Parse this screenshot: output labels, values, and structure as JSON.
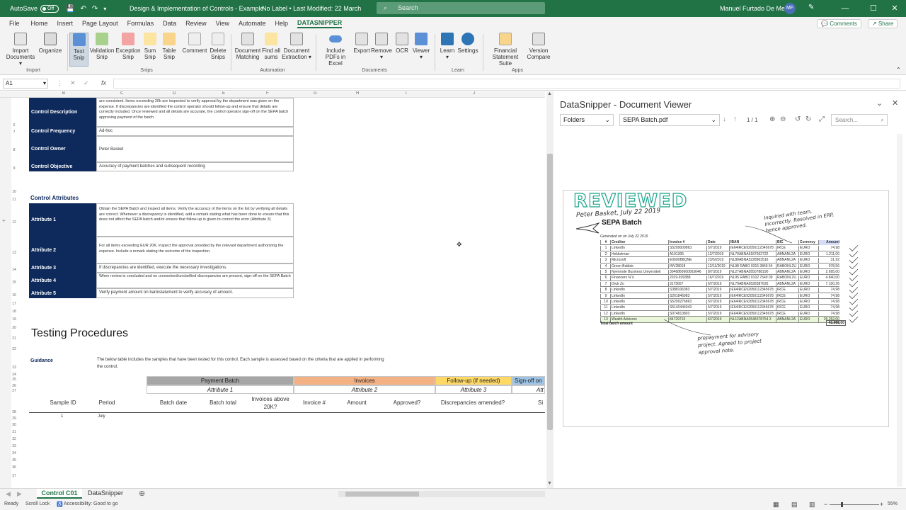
{
  "titlebar": {
    "autosave_label": "AutoSave",
    "autosave_state": "Off",
    "doc_title": "Design & Implementation of Controls - Example",
    "label_status": "No Label • Last Modified: 22 March",
    "search_placeholder": "Search",
    "user_name": "Manuel Furtado De Melo",
    "user_initials": "MF"
  },
  "menu": {
    "items": [
      "File",
      "Home",
      "Insert",
      "Page Layout",
      "Formulas",
      "Data",
      "Review",
      "View",
      "Automate",
      "Help",
      "DATASNIPPER"
    ],
    "comments": "Comments",
    "share": "Share"
  },
  "ribbon": {
    "buttons": [
      "Import Documents",
      "Organize",
      "Text Snip",
      "Validation Snip",
      "Exception Snip",
      "Sum Snip",
      "Table Snip",
      "Comment",
      "Delete Snips",
      "Document Matching",
      "Find all sums",
      "Document Extraction",
      "Include PDFs in Excel",
      "Export",
      "Remove",
      "OCR",
      "Viewer",
      "Learn",
      "Settings",
      "Financial Statement Suite",
      "Version Compare"
    ],
    "groups": [
      "Import",
      "Snips",
      "Automation",
      "Documents",
      "Learn",
      "Apps"
    ]
  },
  "formula_bar": {
    "name_box": "A1",
    "fx": "fx"
  },
  "columns": [
    "B",
    "C",
    "D",
    "E",
    "F",
    "G",
    "H",
    "I",
    "J"
  ],
  "sheet": {
    "control_rows": [
      {
        "label": "Control Description",
        "text": "are consistent. Items exceeding 20k are inspected to verify approval by the department was given on the expense. If discrepancies are identified the control operator should follow-up and ensure that details are correctly included. Once reviewed and all details are accurate, the control operator sign-off on the SEPA batch approving payment of the batch."
      },
      {
        "label": "Control Frequency",
        "text": "Ad-hoc"
      },
      {
        "label": "Control Owner",
        "text": "Peter Basket"
      },
      {
        "label": "Control Objective",
        "text": "Accuracy of payment batches and subsequent recording"
      }
    ],
    "attributes_title": "Control Attributes",
    "attributes": [
      {
        "label": "Attribute 1",
        "text": "Obtain the SEPA Batch and inspect all items. Verify the accuracy of the items on the list by verifying all details are correct. Whenever a discrepancy is identified, add a remark stating what has been done to ensure that this does not affect the SEPA batch and/or ensure that follow-up is given to correct the error (Attribute 3)"
      },
      {
        "label": "Attribute 2",
        "text": "For all items exceeding EUR 20K, inspect the approval provided by the relevant department authorizing the expense. Include a remark stating the outcome of the inspection."
      },
      {
        "label": "Attribute 3",
        "text": "If discrepancies are identified, execute the necessary investigations."
      },
      {
        "label": "Attribute 4",
        "text": "When review is concluded and no unresolved/unclarified discrepancies are present, sign-off on the SEPA Batch"
      },
      {
        "label": "Attribute 5",
        "text": "Verify payment amount on bankstatement to verify accuracy of amount."
      }
    ],
    "testing_title": "Testing Procedures",
    "guidance_label": "Guidance",
    "guidance_text": "The below table includes the samples that have been tested for this control. Each sample is assessed based on the criteria that are applied in performing the control.",
    "groups": [
      {
        "name": "Payment Batch",
        "attr": "Attribute 1",
        "color": "#a6a6a6"
      },
      {
        "name": "Invoices",
        "attr": "Attribute 2",
        "color": "#f4b183"
      },
      {
        "name": "Follow-up (if needed)",
        "attr": "Attribute 3",
        "color": "#ffd966"
      },
      {
        "name": "Sign-off on",
        "attr": "Att",
        "color": "#9dc3e6"
      }
    ],
    "table_columns": [
      "Sample ID",
      "Period",
      "Batch date",
      "Batch total",
      "Invoices above 20K?",
      "Invoice #",
      "Amount",
      "Approved?",
      "Discrepancies amended?",
      "Si"
    ],
    "sample_row": {
      "id": "1",
      "period": "July"
    },
    "row_numbers": [
      "6",
      "7",
      "8",
      "9",
      "10",
      "11",
      "12",
      "13",
      "14",
      "15",
      "16",
      "17",
      "18",
      "19",
      "20",
      "21",
      "22",
      "23",
      "24",
      "25",
      "26",
      "27",
      "28",
      "29",
      "30",
      "31",
      "32",
      "33",
      "34",
      "35",
      "36",
      "37"
    ]
  },
  "viewer": {
    "title": "DataSnipper - Document Viewer",
    "folders": "Folders",
    "file": "SEPA Batch.pdf",
    "page_indicator": "1 / 1",
    "search_placeholder": "Search..."
  },
  "document": {
    "stamp": "REVIEWED",
    "signature": "Peter Basket, July 22 2019",
    "heading": "SEPA Batch",
    "generated": "Generated on on July 22 2019",
    "note_top": "Inquired with team, incorrectly. Resolved in ERP, hence approved.",
    "note_bottom": "prepayment for advisory project. Agreed to project approval note.",
    "headers": [
      "#",
      "Creditor",
      "Invoice #",
      "Date",
      "IBAN",
      "BIC",
      "Currency",
      "Amount"
    ],
    "rows": [
      [
        "1",
        "LinkedIn",
        "S5209009863",
        "5/7/2019",
        "IE64IRCE92050112345678",
        "IRCE",
        "EURO",
        "74,98"
      ],
      [
        "2",
        "Hekkelman",
        "A191305",
        "12/7/2019",
        "NL70ABNA6187602722",
        "ABNANL2A",
        "EURO",
        "1.211,00"
      ],
      [
        "3",
        "Microsoft",
        "E0600B8QNE",
        "23/6/2019",
        "NL88ABNA5228863516",
        "ABNANL2A",
        "EURO",
        "31,92"
      ],
      [
        "4",
        "Green Bubble",
        "INV28018",
        "12/11/2019",
        "NL98 RABO 0315 3849 64",
        "RABONL2U",
        "EURO",
        "978,56"
      ],
      [
        "5",
        "Nyenrode Business Universiteit",
        "3046860600063646",
        "8/7/2019",
        "NL27ABNA0550788190",
        "ABNANL2A",
        "EURO",
        "2.695,00"
      ],
      [
        "6",
        "Financers N.V.",
        "2019-939388",
        "16/7/2019",
        "NL95 RABO 0102 7649 09",
        "RABONL2U",
        "EURO",
        "4.840,00"
      ],
      [
        "7",
        "Druk Zo",
        "3175657",
        "6/7/2019",
        "NL79ABNA0528387626",
        "ABNANL2A",
        "EURO",
        "7.100,26"
      ],
      [
        "8",
        "LinkedIn",
        "S388106383",
        "5/7/2019",
        "IE64IRCE92050112345678",
        "IRCE",
        "EURO",
        "74,98"
      ],
      [
        "9",
        "LinkedIn",
        "S261846983",
        "5/7/2019",
        "IE64IRCE92050112345678",
        "IRCE",
        "EURO",
        "74,98"
      ],
      [
        "10",
        "LinkedIn",
        "S5209276863",
        "5/7/2019",
        "IE64IRCE92050112345678",
        "IRCE",
        "EURO",
        "74,98"
      ],
      [
        "11",
        "LinkedIn",
        "S5140444043",
        "5/7/2019",
        "IE64IRCE92050112345678",
        "IRCE",
        "EURO",
        "74,98"
      ],
      [
        "12",
        "LinkedIn",
        "S074813803",
        "5/7/2019",
        "IE64IRCE92050112345678",
        "IRCE",
        "EURO",
        "74,98"
      ],
      [
        "13",
        "Wealth Advisors",
        "84729710",
        "6/7/2019",
        "NL12ABNA0548378754 3",
        "ABNANL2A",
        "EURO",
        "25.252,00"
      ]
    ],
    "total_label": "Total batch amount",
    "total_value": "41.958,00"
  },
  "tabs": {
    "sheets": [
      "Control C01",
      "DataSnipper"
    ],
    "active": "Control C01"
  },
  "status": {
    "ready": "Ready",
    "scroll_lock": "Scroll Lock",
    "accessibility": "Accessibility: Good to go",
    "zoom": "55%"
  },
  "colors": {
    "excel_green": "#217346",
    "navy": "#0e2a5c"
  }
}
